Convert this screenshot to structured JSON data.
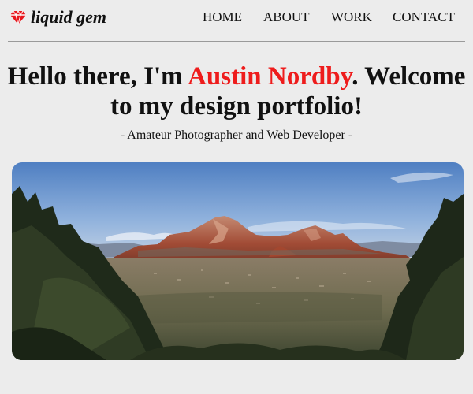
{
  "header": {
    "logo_text": "liquid gem",
    "logo_icon": "gem-icon"
  },
  "nav": {
    "items": [
      {
        "label": "HOME"
      },
      {
        "label": "ABOUT"
      },
      {
        "label": "WORK"
      },
      {
        "label": "CONTACT"
      }
    ]
  },
  "hero": {
    "greeting": "Hello there, I'm ",
    "name": "Austin Nordby",
    "welcome": ". Welcome to my design portfolio!",
    "subtitle": "- Amateur Photographer and Web Developer -",
    "image_subject": "desert-landscape-photo"
  },
  "colors": {
    "background": "#ececec",
    "accent": "#ee1c1c",
    "text": "#111111"
  }
}
